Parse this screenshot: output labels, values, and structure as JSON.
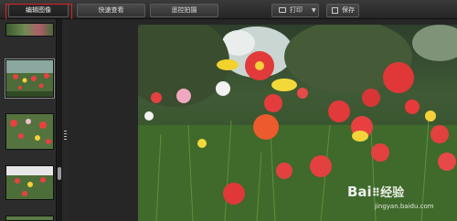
{
  "toolbar": {
    "edit_label": "编辑图像",
    "quick_view_label": "快速查看",
    "remote_shoot_label": "遥控拍摄",
    "print_label": "打印",
    "save_label": "保存"
  },
  "filmstrip": {
    "thumbnail_count": 5,
    "selected_index": 1
  },
  "watermark": {
    "brand": "Bai",
    "brand_cn": "经验",
    "url": "jingyan.baidu.com"
  }
}
